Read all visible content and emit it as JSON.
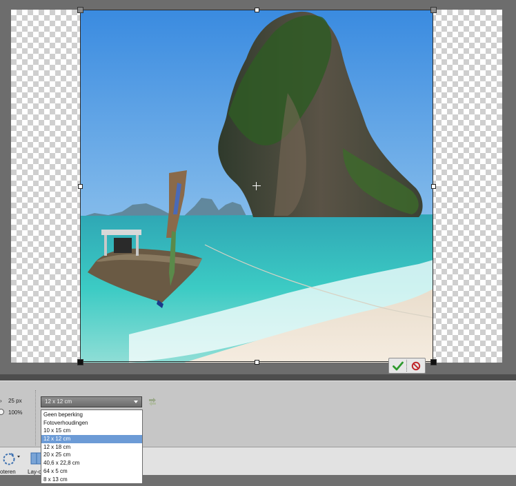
{
  "options": {
    "size_value": "25 px",
    "zoom_value": "100%",
    "preset_select": "12 x 12 cm"
  },
  "preset_dropdown": {
    "items": [
      {
        "label": "Geen beperking"
      },
      {
        "label": "Fotoverhoudingen"
      },
      {
        "label": "10 x 15 cm"
      },
      {
        "label": "12 x 12 cm"
      },
      {
        "label": "12 x 18 cm"
      },
      {
        "label": "20 x 25 cm"
      },
      {
        "label": "40,6 x 22,8 cm"
      },
      {
        "label": "64 x 5 cm"
      },
      {
        "label": "8 x 13 cm"
      }
    ],
    "selected_index": 3
  },
  "bottom_panel": {
    "rotate_label": "oteren",
    "layout_label": "Lay-o"
  },
  "colors": {
    "workspace": "#6d6d6d",
    "options_bar": "#c6c6c6",
    "selection": "#6c9bd6",
    "commit_green": "#2e9a2e",
    "cancel_red": "#c0262b"
  },
  "icons": [
    "commit-check-icon",
    "cancel-icon",
    "swap-orientation-icon",
    "rotate-icon",
    "layout-icon",
    "crosshair-icon"
  ]
}
